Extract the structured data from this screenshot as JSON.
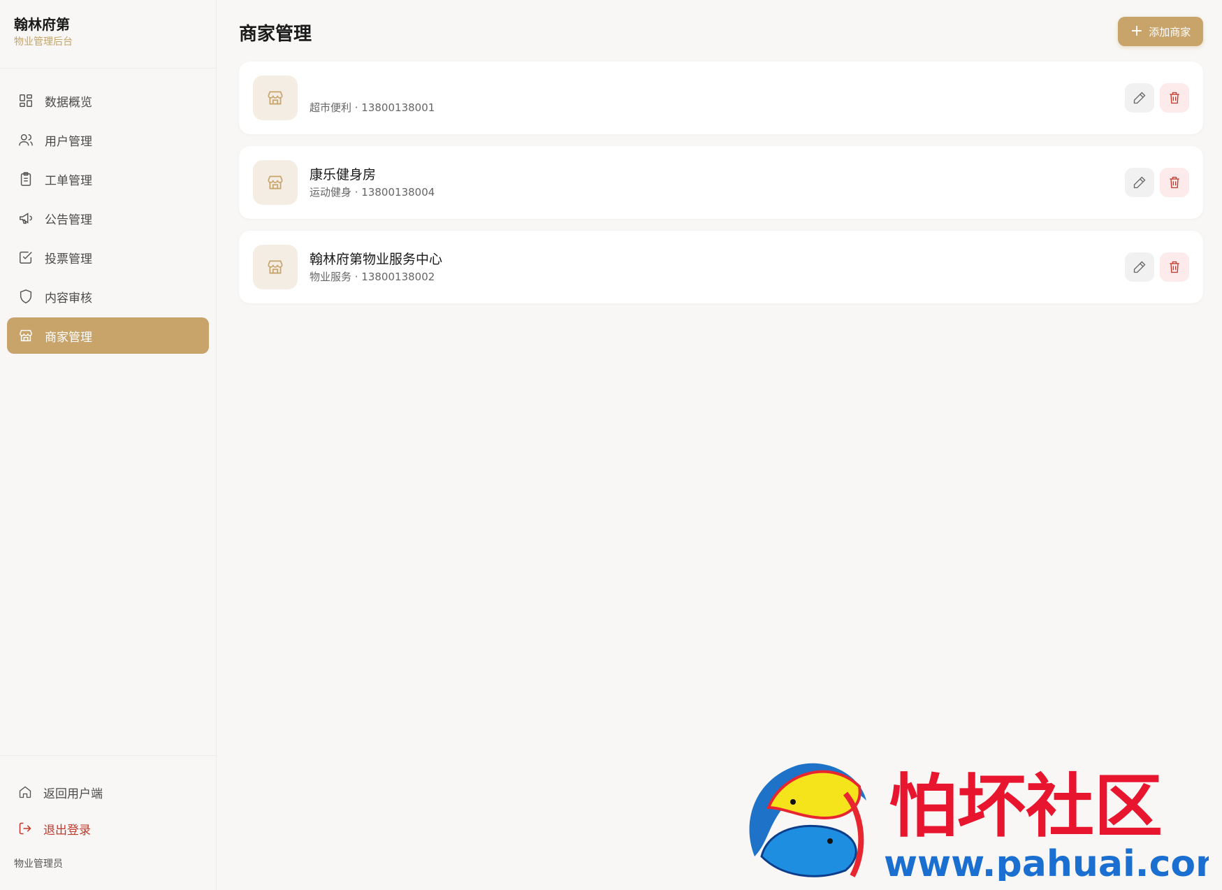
{
  "sidebar": {
    "brand_title": "翰林府第",
    "brand_subtitle": "物业管理后台",
    "items": [
      {
        "label": "数据概览",
        "icon": "grid-icon"
      },
      {
        "label": "用户管理",
        "icon": "users-icon"
      },
      {
        "label": "工单管理",
        "icon": "clipboard-icon"
      },
      {
        "label": "公告管理",
        "icon": "megaphone-icon"
      },
      {
        "label": "投票管理",
        "icon": "checkbox-icon"
      },
      {
        "label": "内容审核",
        "icon": "shield-icon"
      },
      {
        "label": "商家管理",
        "icon": "store-icon",
        "active": true
      }
    ],
    "footer": {
      "back_label": "返回用户端",
      "logout_label": "退出登录",
      "role": "物业管理员"
    }
  },
  "main": {
    "title": "商家管理",
    "add_button_label": "添加商家",
    "merchants": [
      {
        "name": "",
        "meta": "超市便利 · 13800138001"
      },
      {
        "name": "康乐健身房",
        "meta": "运动健身 · 13800138004"
      },
      {
        "name": "翰林府第物业服务中心",
        "meta": "物业服务 · 13800138002"
      }
    ]
  },
  "watermark": {
    "text": "怕坏社区",
    "url": "www.pahuai.com"
  },
  "colors": {
    "accent": "#c8a46a",
    "danger": "#c0392b",
    "background": "#f8f7f5"
  }
}
